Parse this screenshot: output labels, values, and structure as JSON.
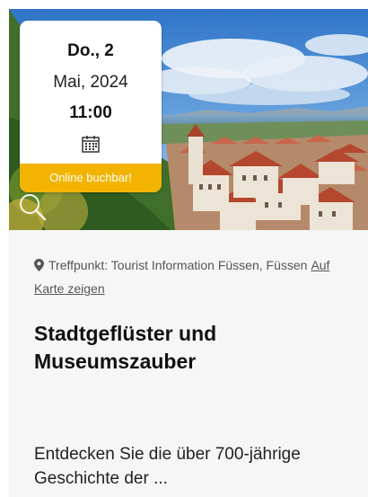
{
  "event_card": {
    "date": {
      "day": "Do., 2",
      "month_year": "Mai, 2024",
      "time": "11:00",
      "calendar_icon": "calendar-icon"
    },
    "booking_badge": "Online buchbar!",
    "zoom_icon": "magnifier-icon",
    "meeting_point": {
      "icon": "location-pin-icon",
      "text": "Treffpunkt: Tourist Information Füssen, Füssen",
      "map_link": "Auf Karte zeigen"
    },
    "title": "Stadtgeflüster und Museumszauber",
    "description": "Entdecken Sie die über 700-jährige Geschichte der ...",
    "colors": {
      "badge": "#f2b400",
      "card_background": "#f6f6f6"
    }
  }
}
